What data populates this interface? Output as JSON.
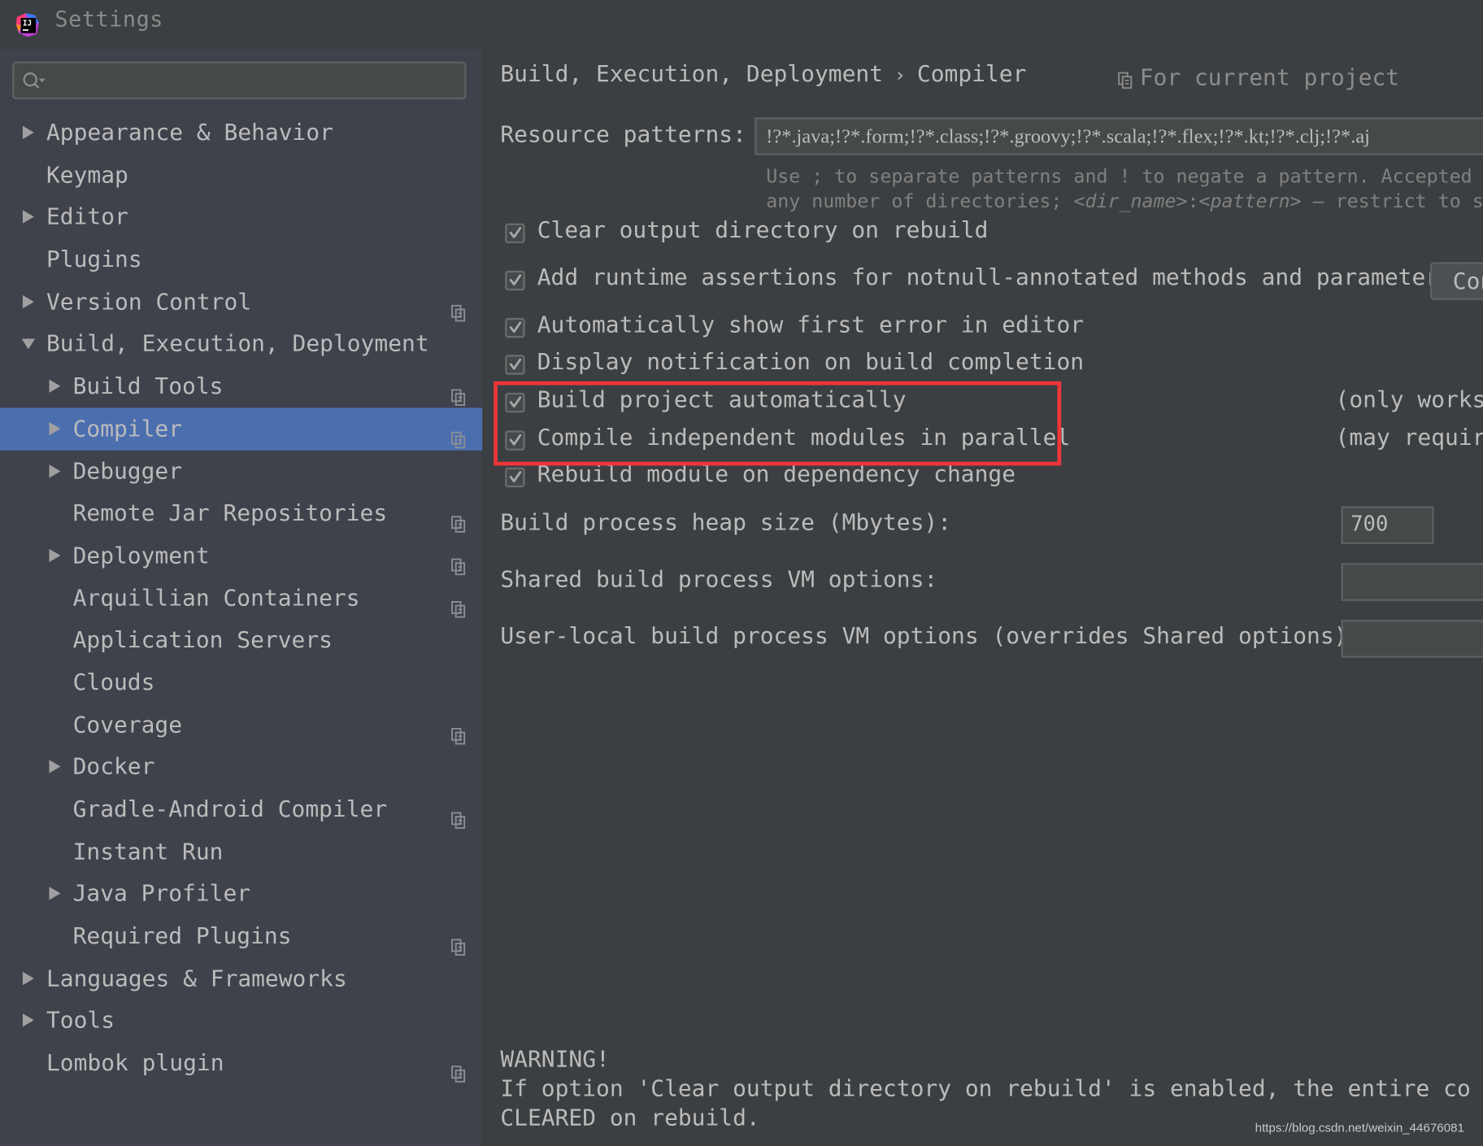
{
  "window": {
    "title": "Settings",
    "app_icon": "intellij-idea-logo"
  },
  "sidebar": {
    "search": {
      "placeholder": "",
      "value": "",
      "icon": "search-icon"
    },
    "items": [
      {
        "label": "Appearance & Behavior",
        "level": 0,
        "expandable": true,
        "expanded": false,
        "project_scoped": false
      },
      {
        "label": "Keymap",
        "level": 0,
        "expandable": false,
        "project_scoped": false
      },
      {
        "label": "Editor",
        "level": 0,
        "expandable": true,
        "expanded": false,
        "project_scoped": false
      },
      {
        "label": "Plugins",
        "level": 0,
        "expandable": false,
        "project_scoped": false
      },
      {
        "label": "Version Control",
        "level": 0,
        "expandable": true,
        "expanded": false,
        "project_scoped": true
      },
      {
        "label": "Build, Execution, Deployment",
        "level": 0,
        "expandable": true,
        "expanded": true,
        "project_scoped": false
      },
      {
        "label": "Build Tools",
        "level": 1,
        "expandable": true,
        "expanded": false,
        "project_scoped": true
      },
      {
        "label": "Compiler",
        "level": 1,
        "expandable": true,
        "expanded": false,
        "project_scoped": true,
        "selected": true
      },
      {
        "label": "Debugger",
        "level": 1,
        "expandable": true,
        "expanded": false,
        "project_scoped": false
      },
      {
        "label": "Remote Jar Repositories",
        "level": 1,
        "expandable": false,
        "project_scoped": true
      },
      {
        "label": "Deployment",
        "level": 1,
        "expandable": true,
        "expanded": false,
        "project_scoped": true
      },
      {
        "label": "Arquillian Containers",
        "level": 1,
        "expandable": false,
        "project_scoped": true
      },
      {
        "label": "Application Servers",
        "level": 1,
        "expandable": false,
        "project_scoped": false
      },
      {
        "label": "Clouds",
        "level": 1,
        "expandable": false,
        "project_scoped": false
      },
      {
        "label": "Coverage",
        "level": 1,
        "expandable": false,
        "project_scoped": true
      },
      {
        "label": "Docker",
        "level": 1,
        "expandable": true,
        "expanded": false,
        "project_scoped": false
      },
      {
        "label": "Gradle-Android Compiler",
        "level": 1,
        "expandable": false,
        "project_scoped": true
      },
      {
        "label": "Instant Run",
        "level": 1,
        "expandable": false,
        "project_scoped": false
      },
      {
        "label": "Java Profiler",
        "level": 1,
        "expandable": true,
        "expanded": false,
        "project_scoped": false
      },
      {
        "label": "Required Plugins",
        "level": 1,
        "expandable": false,
        "project_scoped": true
      },
      {
        "label": "Languages & Frameworks",
        "level": 0,
        "expandable": true,
        "expanded": false,
        "project_scoped": false
      },
      {
        "label": "Tools",
        "level": 0,
        "expandable": true,
        "expanded": false,
        "project_scoped": false
      },
      {
        "label": "Lombok plugin",
        "level": 0,
        "expandable": false,
        "project_scoped": true
      }
    ]
  },
  "main": {
    "breadcrumb": [
      "Build, Execution, Deployment",
      "Compiler"
    ],
    "breadcrumb_separator": "›",
    "scope_label": "For current project",
    "resource_patterns": {
      "label": "Resource patterns:",
      "value": "!?*.java;!?*.form;!?*.class;!?*.groovy;!?*.scala;!?*.flex;!?*.kt;!?*.clj;!?*.aj",
      "hint_line1": "Use ; to separate patterns and ! to negate a pattern. Accepted wildcards: ? — exactly one symbol; * — zero or more symbols; / — path separator; /**/ — any number of directories;",
      "hint_line1_visible": "Use ; to separate patterns and ! to negate a pattern. Accepted wildc",
      "hint_line2_prefix": "any number of directories; ",
      "hint_line2_dir": "<dir_name>",
      "hint_line2_colon": ":",
      "hint_line2_pattern": "<pattern>",
      "hint_line2_suffix": " – restrict to source"
    },
    "checkboxes": [
      {
        "label": "Clear output directory on rebuild",
        "checked": true
      },
      {
        "label": "Add runtime assertions for notnull-annotated methods and parameters",
        "checked": true
      },
      {
        "label": "Automatically show first error in editor",
        "checked": true
      },
      {
        "label": "Display notification on build completion",
        "checked": true
      },
      {
        "label": "Build project automatically",
        "checked": true,
        "note": "(only works"
      },
      {
        "label": "Compile independent modules in parallel",
        "checked": true,
        "note": "(may require"
      },
      {
        "label": "Rebuild module on dependency change",
        "checked": true
      }
    ],
    "configure_button": "Con",
    "heap_size": {
      "label": "Build process heap size (Mbytes):",
      "value": "700"
    },
    "shared_vm": {
      "label": "Shared build process VM options:",
      "value": ""
    },
    "user_vm": {
      "label": "User-local build process VM options (overrides Shared options):",
      "value": ""
    },
    "warning": {
      "title": "WARNING!",
      "line1": "If option 'Clear output directory on rebuild' is enabled, the entire co",
      "line2": "CLEARED on rebuild."
    },
    "highlight_color": "#f0353a"
  },
  "watermark": "https://blog.csdn.net/weixin_44676081",
  "colors": {
    "background": "#3c3f41",
    "sidebar": "#3f424b",
    "selection": "#4b6eaf",
    "text": "#bbbbbb"
  }
}
